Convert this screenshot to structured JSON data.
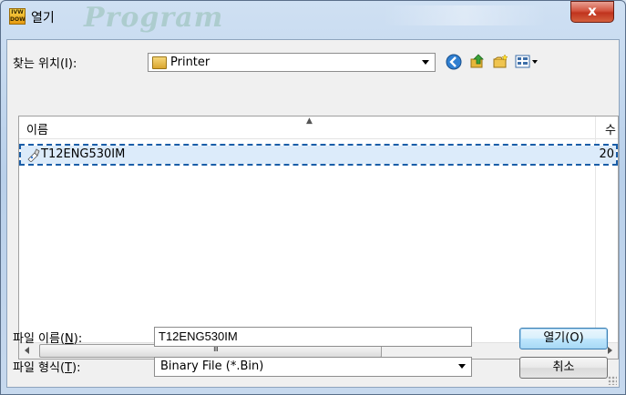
{
  "window": {
    "title": "열기",
    "app_icon_text": "IVW DOWN",
    "background_watermark": "Program",
    "close_glyph": "x"
  },
  "lookin": {
    "label": "찾는 위치(I):",
    "value": "Printer"
  },
  "toolbar": {
    "icons": [
      "back-icon",
      "up-folder-icon",
      "new-folder-icon",
      "view-menu-icon"
    ]
  },
  "file_list": {
    "columns": {
      "name": "이름",
      "size": "수"
    },
    "rows": [
      {
        "name": "T12ENG530IM",
        "size": "20"
      }
    ],
    "scrollbar_grip": "III"
  },
  "filename": {
    "label_prefix": "파일 이름(",
    "label_key": "N",
    "label_suffix": "):",
    "value": "T12ENG530IM"
  },
  "filetype": {
    "label_prefix": "파일 형식(",
    "label_key": "T",
    "label_suffix": "):",
    "value": "Binary File (*.Bin)"
  },
  "buttons": {
    "open": "열기(O)",
    "cancel": "취소"
  }
}
